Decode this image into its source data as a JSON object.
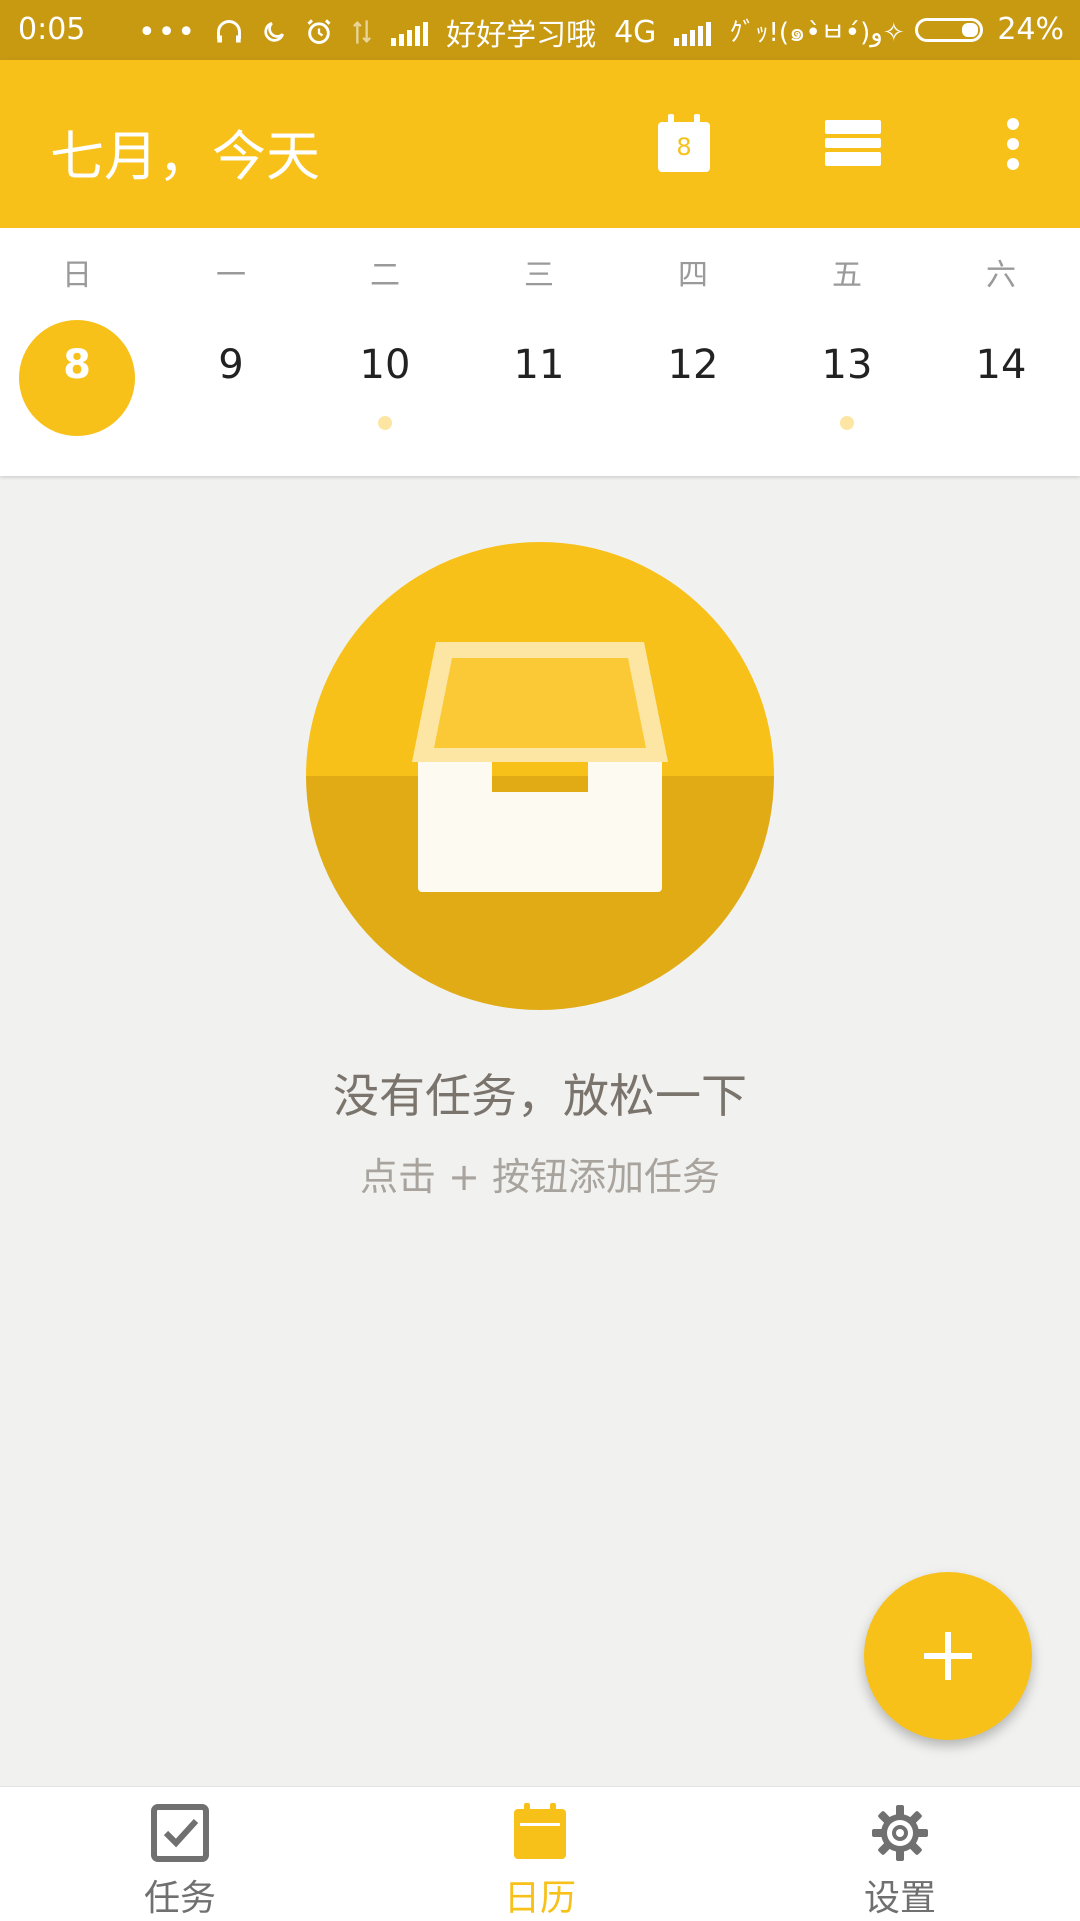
{
  "status_bar": {
    "time": "0:05",
    "carrier": "好好学习哦",
    "network": "4G",
    "second_carrier": "ｸﾞｯ!(๑•̀ㅂ•́)و✧",
    "battery_percent": "24%",
    "battery_level": 0.24
  },
  "app_bar": {
    "title": "七月，今天",
    "calendar_icon_day": "8",
    "icons": [
      "calendar-today-icon",
      "view-list-icon",
      "more-vert-icon"
    ]
  },
  "week": {
    "weekdays": [
      "日",
      "一",
      "二",
      "三",
      "四",
      "五",
      "六"
    ],
    "days": [
      {
        "num": "8",
        "today": true,
        "has_task": false
      },
      {
        "num": "9",
        "today": false,
        "has_task": false
      },
      {
        "num": "10",
        "today": false,
        "has_task": true
      },
      {
        "num": "11",
        "today": false,
        "has_task": false
      },
      {
        "num": "12",
        "today": false,
        "has_task": false
      },
      {
        "num": "13",
        "today": false,
        "has_task": true
      },
      {
        "num": "14",
        "today": false,
        "has_task": false
      }
    ]
  },
  "empty_state": {
    "title": "没有任务，放松一下",
    "subtitle": "点击 + 按钮添加任务"
  },
  "fab": {
    "icon": "plus-icon"
  },
  "bottom_nav": {
    "items": [
      {
        "label": "任务",
        "icon": "task-checkbox-icon",
        "active": false
      },
      {
        "label": "日历",
        "icon": "calendar-icon",
        "active": true
      },
      {
        "label": "设置",
        "icon": "gear-icon",
        "active": false
      }
    ]
  },
  "colors": {
    "accent": "#f7c119",
    "status_bar": "#c89a12",
    "background": "#f1f1f0"
  }
}
